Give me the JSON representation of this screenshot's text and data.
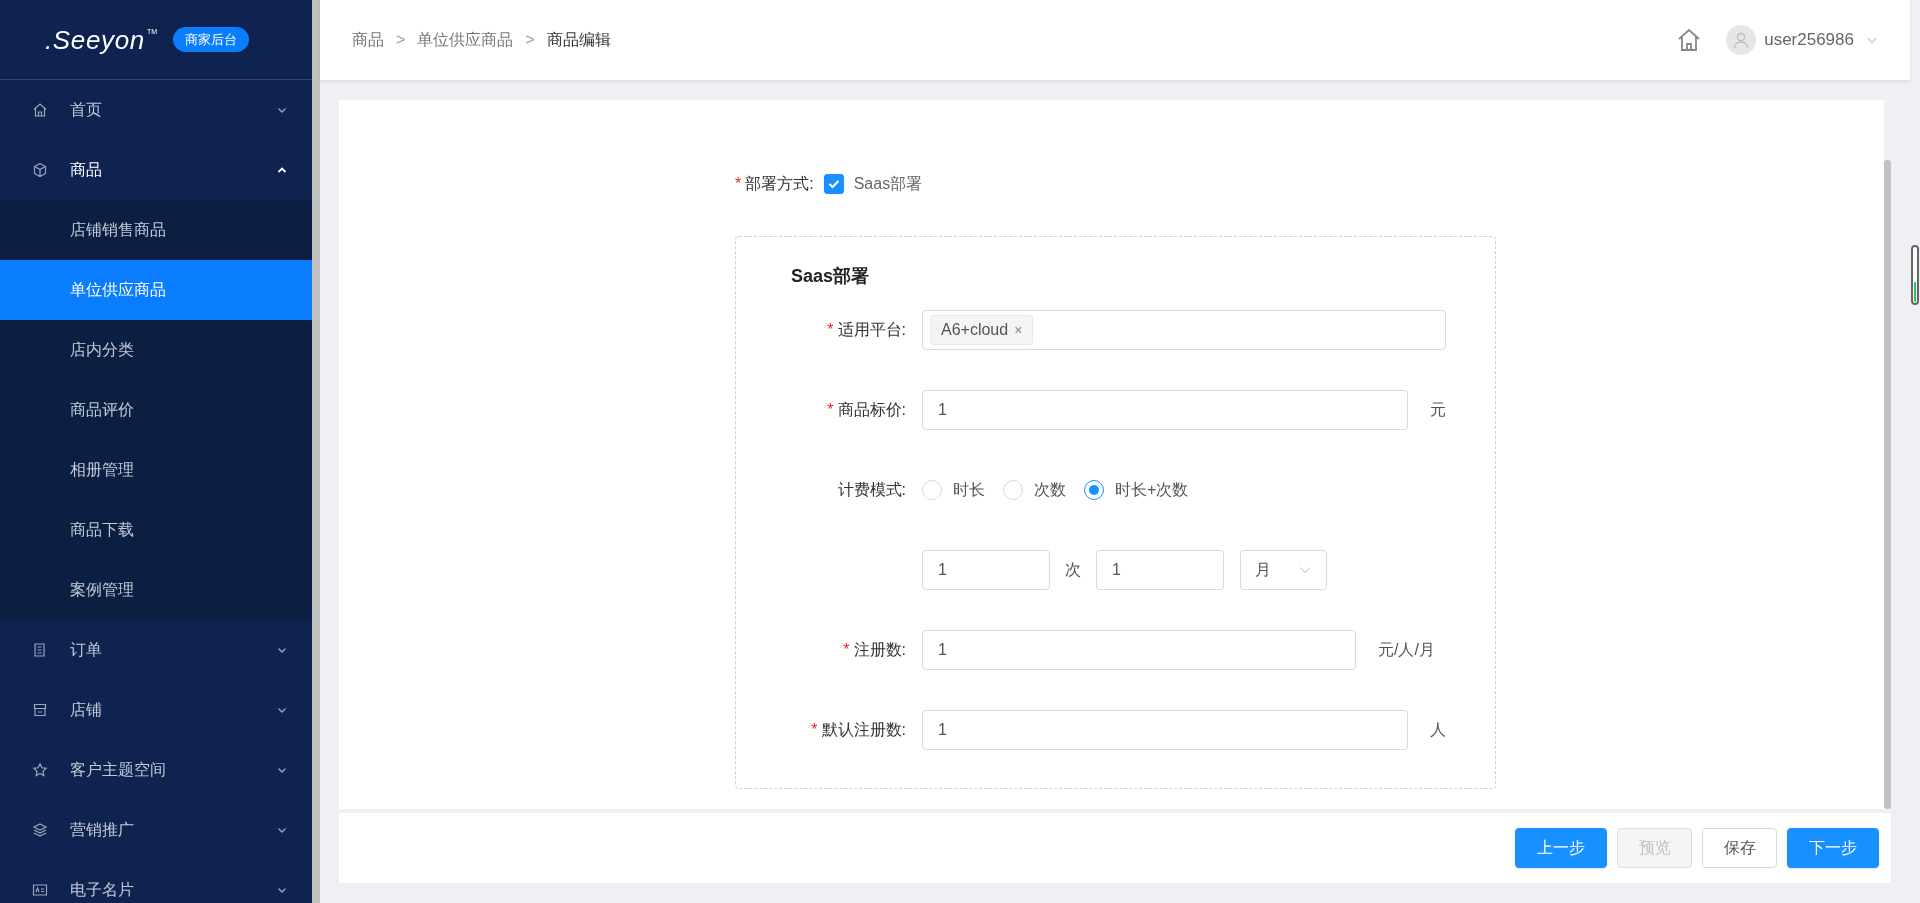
{
  "sidebar": {
    "logo": ".Seeyon",
    "logo_mark": "TM",
    "badge": "商家后台",
    "menu": [
      {
        "label": "首页",
        "expanded": false,
        "selected": false
      },
      {
        "label": "商品",
        "expanded": true,
        "selected": false,
        "children": [
          {
            "label": "店铺销售商品",
            "selected": false
          },
          {
            "label": "单位供应商品",
            "selected": true
          },
          {
            "label": "店内分类",
            "selected": false
          },
          {
            "label": "商品评价",
            "selected": false
          },
          {
            "label": "相册管理",
            "selected": false
          },
          {
            "label": "商品下载",
            "selected": false
          },
          {
            "label": "案例管理",
            "selected": false
          }
        ]
      },
      {
        "label": "订单",
        "expanded": false,
        "selected": false
      },
      {
        "label": "店铺",
        "expanded": false,
        "selected": false
      },
      {
        "label": "客户主题空间",
        "expanded": false,
        "selected": false
      },
      {
        "label": "营销推广",
        "expanded": false,
        "selected": false
      },
      {
        "label": "电子名片",
        "expanded": false,
        "selected": false
      }
    ]
  },
  "header": {
    "breadcrumb": [
      "商品",
      "单位供应商品",
      "商品编辑"
    ],
    "separator": ">",
    "user": "user256986"
  },
  "form": {
    "required_mark": "*",
    "deploy": {
      "label": "部署方式:",
      "required": true,
      "option": "Saas部署",
      "checked": true
    },
    "section_title": "Saas部署",
    "fields": [
      {
        "kind": "tags",
        "label": "适用平台:",
        "required": true,
        "tags": [
          {
            "label": "A6+cloud",
            "remove": "×"
          }
        ]
      },
      {
        "kind": "input",
        "label": "商品标价:",
        "required": true,
        "value": "1",
        "unit": "元"
      },
      {
        "kind": "radio",
        "label": "计费模式:",
        "required": false,
        "options": [
          {
            "label": "时长",
            "selected": false
          },
          {
            "label": "次数",
            "selected": false
          },
          {
            "label": "时长+次数",
            "selected": true
          }
        ]
      },
      {
        "kind": "combo",
        "value_1": "1",
        "between": "次",
        "value_2": "1",
        "select": "月"
      },
      {
        "kind": "input",
        "label": "注册数:",
        "required": true,
        "value": "1",
        "unit": "元/人/月"
      },
      {
        "kind": "input",
        "label": "默认注册数:",
        "required": true,
        "value": "1",
        "unit": "人"
      }
    ]
  },
  "footer": {
    "buttons": [
      {
        "label": "上一步",
        "kind": "primary"
      },
      {
        "label": "预览",
        "kind": "disabled"
      },
      {
        "label": "保存",
        "kind": "default"
      },
      {
        "label": "下一步",
        "kind": "primary"
      }
    ]
  }
}
